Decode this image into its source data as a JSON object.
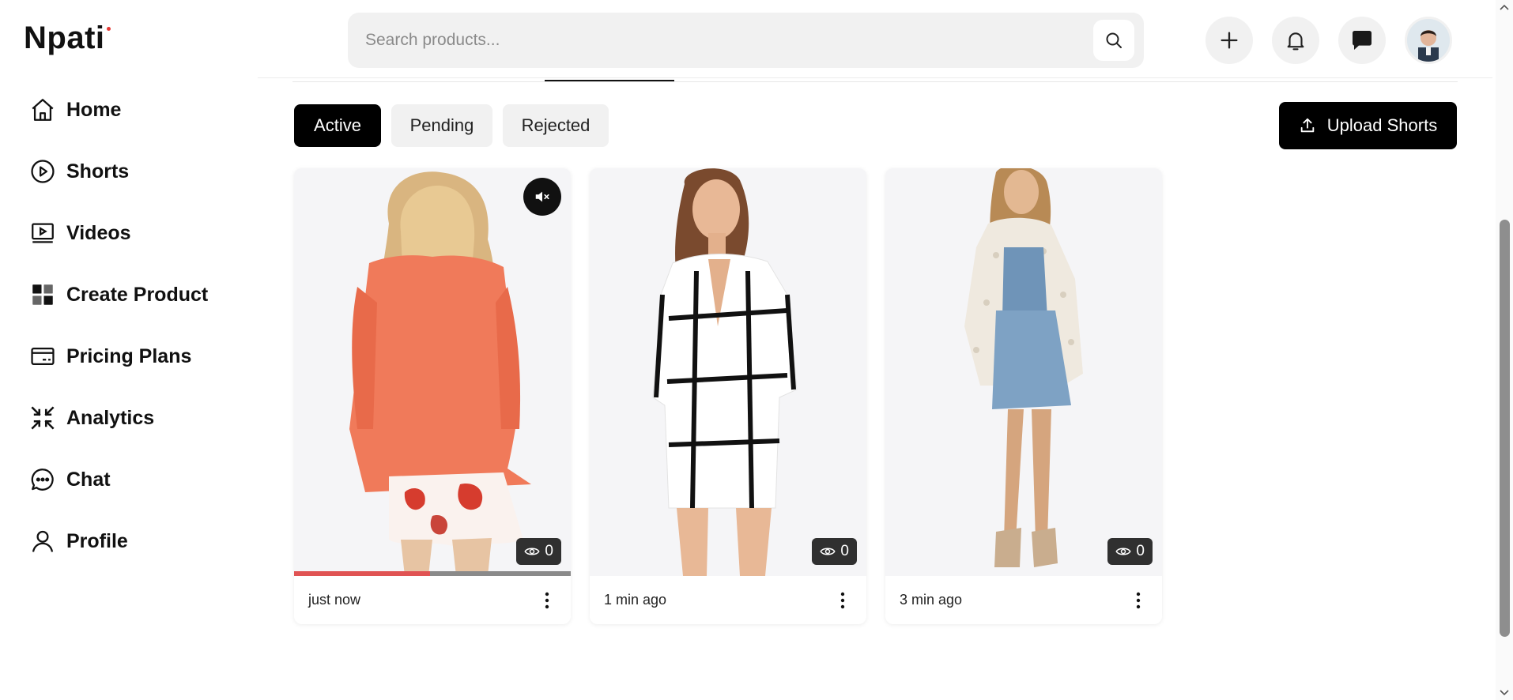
{
  "brand": {
    "logo_text": "Npati",
    "accent": "#e53935"
  },
  "sidebar": {
    "items": [
      {
        "label": "Home",
        "icon": "home-icon"
      },
      {
        "label": "Shorts",
        "icon": "play-circle-icon"
      },
      {
        "label": "Videos",
        "icon": "video-icon"
      },
      {
        "label": "Create Product",
        "icon": "plus-icon"
      },
      {
        "label": "Pricing Plans",
        "icon": "card-icon"
      },
      {
        "label": "Analytics",
        "icon": "analytics-icon"
      },
      {
        "label": "Chat",
        "icon": "chat-icon"
      },
      {
        "label": "Profile",
        "icon": "user-icon"
      }
    ]
  },
  "header": {
    "search": {
      "placeholder": "Search products...",
      "value": ""
    },
    "actions": [
      "add-icon",
      "bell-icon",
      "message-icon",
      "avatar"
    ]
  },
  "filters": {
    "tabs": [
      {
        "label": "Active",
        "selected": true
      },
      {
        "label": "Pending",
        "selected": false
      },
      {
        "label": "Rejected",
        "selected": false
      }
    ],
    "upload_label": "Upload Shorts"
  },
  "shorts": [
    {
      "time": "just now",
      "views": "0",
      "muted": true,
      "progress": 0.49,
      "image": "orange-blazer-model"
    },
    {
      "time": "1 min ago",
      "views": "0",
      "muted": false,
      "progress": 0,
      "image": "white-check-playsuit-model"
    },
    {
      "time": "3 min ago",
      "views": "0",
      "muted": false,
      "progress": 0,
      "image": "denim-overall-dress-model"
    }
  ]
}
